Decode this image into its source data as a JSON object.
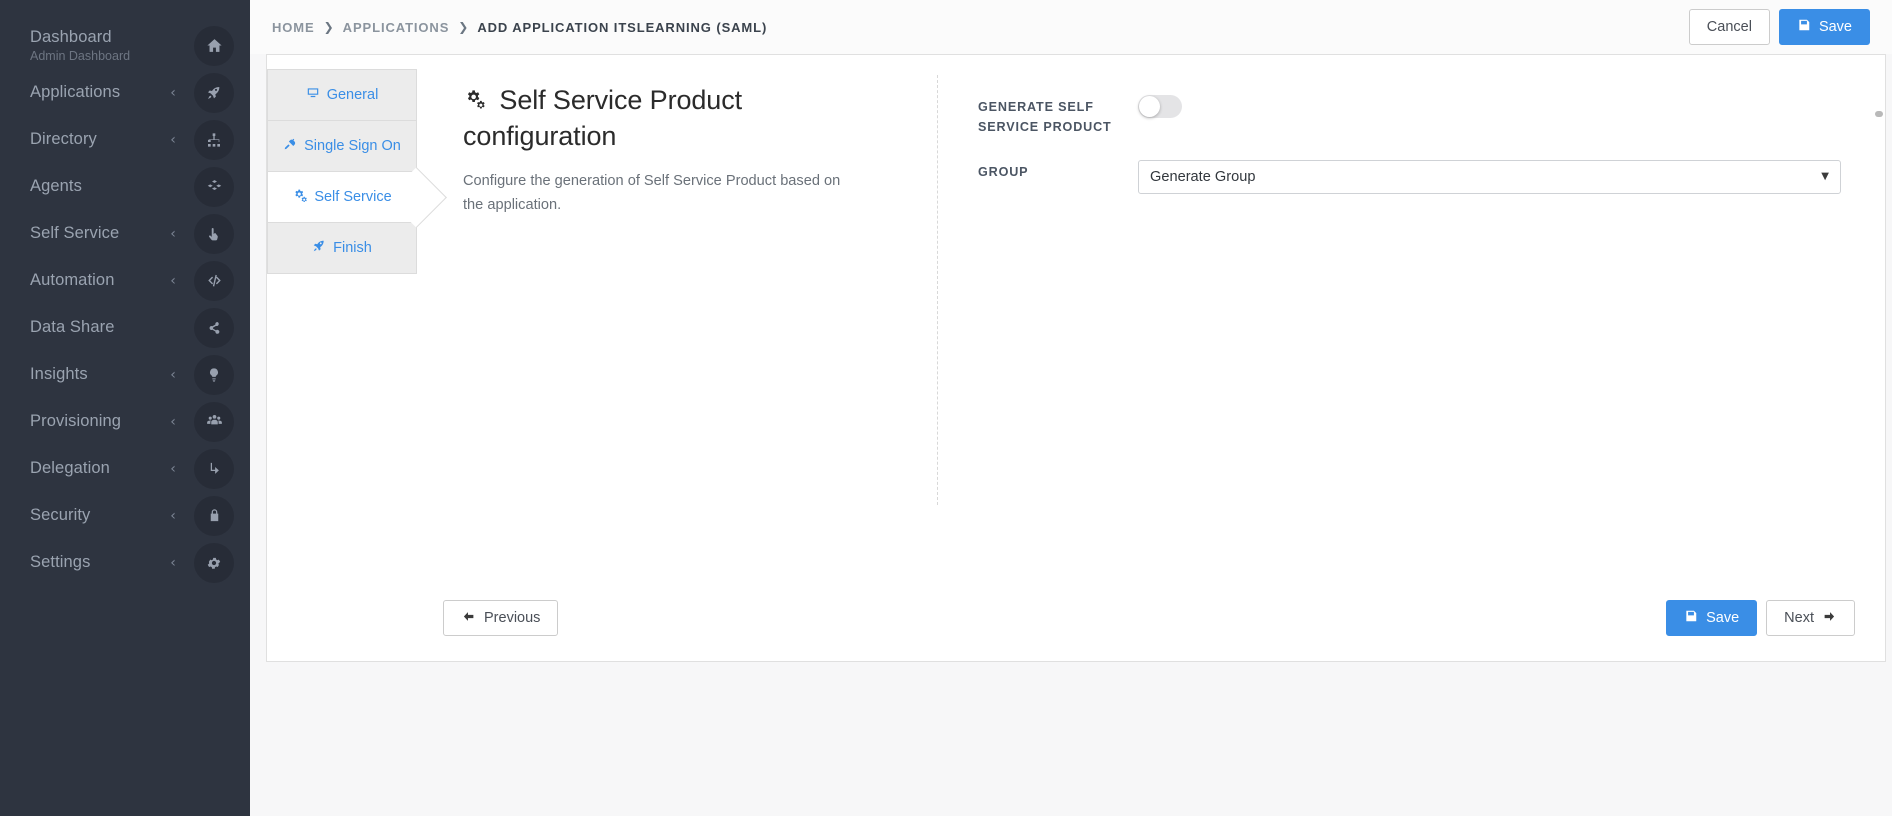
{
  "sidebar": {
    "items": [
      {
        "label": "Dashboard",
        "sub": "Admin Dashboard",
        "icon": "home-icon",
        "caret": false
      },
      {
        "label": "Applications",
        "sub": "",
        "icon": "rocket-icon",
        "caret": true
      },
      {
        "label": "Directory",
        "sub": "",
        "icon": "sitemap-icon",
        "caret": true
      },
      {
        "label": "Agents",
        "sub": "",
        "icon": "cubes-icon",
        "caret": false
      },
      {
        "label": "Self Service",
        "sub": "",
        "icon": "hand-pointer-icon",
        "caret": true
      },
      {
        "label": "Automation",
        "sub": "",
        "icon": "code-icon",
        "caret": true
      },
      {
        "label": "Data Share",
        "sub": "",
        "icon": "share-icon",
        "caret": false
      },
      {
        "label": "Insights",
        "sub": "",
        "icon": "lightbulb-icon",
        "caret": true
      },
      {
        "label": "Provisioning",
        "sub": "",
        "icon": "users-icon",
        "caret": true
      },
      {
        "label": "Delegation",
        "sub": "",
        "icon": "level-down-icon",
        "caret": true
      },
      {
        "label": "Security",
        "sub": "",
        "icon": "lock-icon",
        "caret": true
      },
      {
        "label": "Settings",
        "sub": "",
        "icon": "gear-icon",
        "caret": true
      }
    ],
    "caret_glyph": "‹"
  },
  "topbar": {
    "breadcrumb": [
      {
        "label": "HOME",
        "current": false
      },
      {
        "label": "APPLICATIONS",
        "current": false
      },
      {
        "label": "ADD APPLICATION ITSLEARNING (SAML)",
        "current": true
      }
    ],
    "separator": "❯",
    "cancel_label": "Cancel",
    "save_label": "Save"
  },
  "wizard": {
    "steps": [
      {
        "label": "General",
        "icon": "desktop-icon",
        "active": false
      },
      {
        "label": "Single Sign On",
        "icon": "plug-icon",
        "active": false
      },
      {
        "label": "Self Service",
        "icon": "cogs-icon",
        "active": true
      },
      {
        "label": "Finish",
        "icon": "rocket-icon",
        "active": false
      }
    ]
  },
  "content": {
    "title": "Self Service Product configuration",
    "title_icon": "cogs-icon",
    "description": "Configure the generation of Self Service Product based on the application.",
    "fields": [
      {
        "label": "GENERATE SELF SERVICE PRODUCT",
        "type": "toggle",
        "value": "off"
      },
      {
        "label": "GROUP",
        "type": "select",
        "value": "Generate Group",
        "caret": "▼"
      }
    ]
  },
  "footer": {
    "previous_label": "Previous",
    "save_label": "Save",
    "next_label": "Next",
    "prev_arrow": "←",
    "next_arrow": "→"
  },
  "colors": {
    "accent": "#3a8ee6",
    "sidebar_bg": "#2e3440",
    "page_bg": "#f7f7f8",
    "panel_bg": "#ffffff"
  }
}
